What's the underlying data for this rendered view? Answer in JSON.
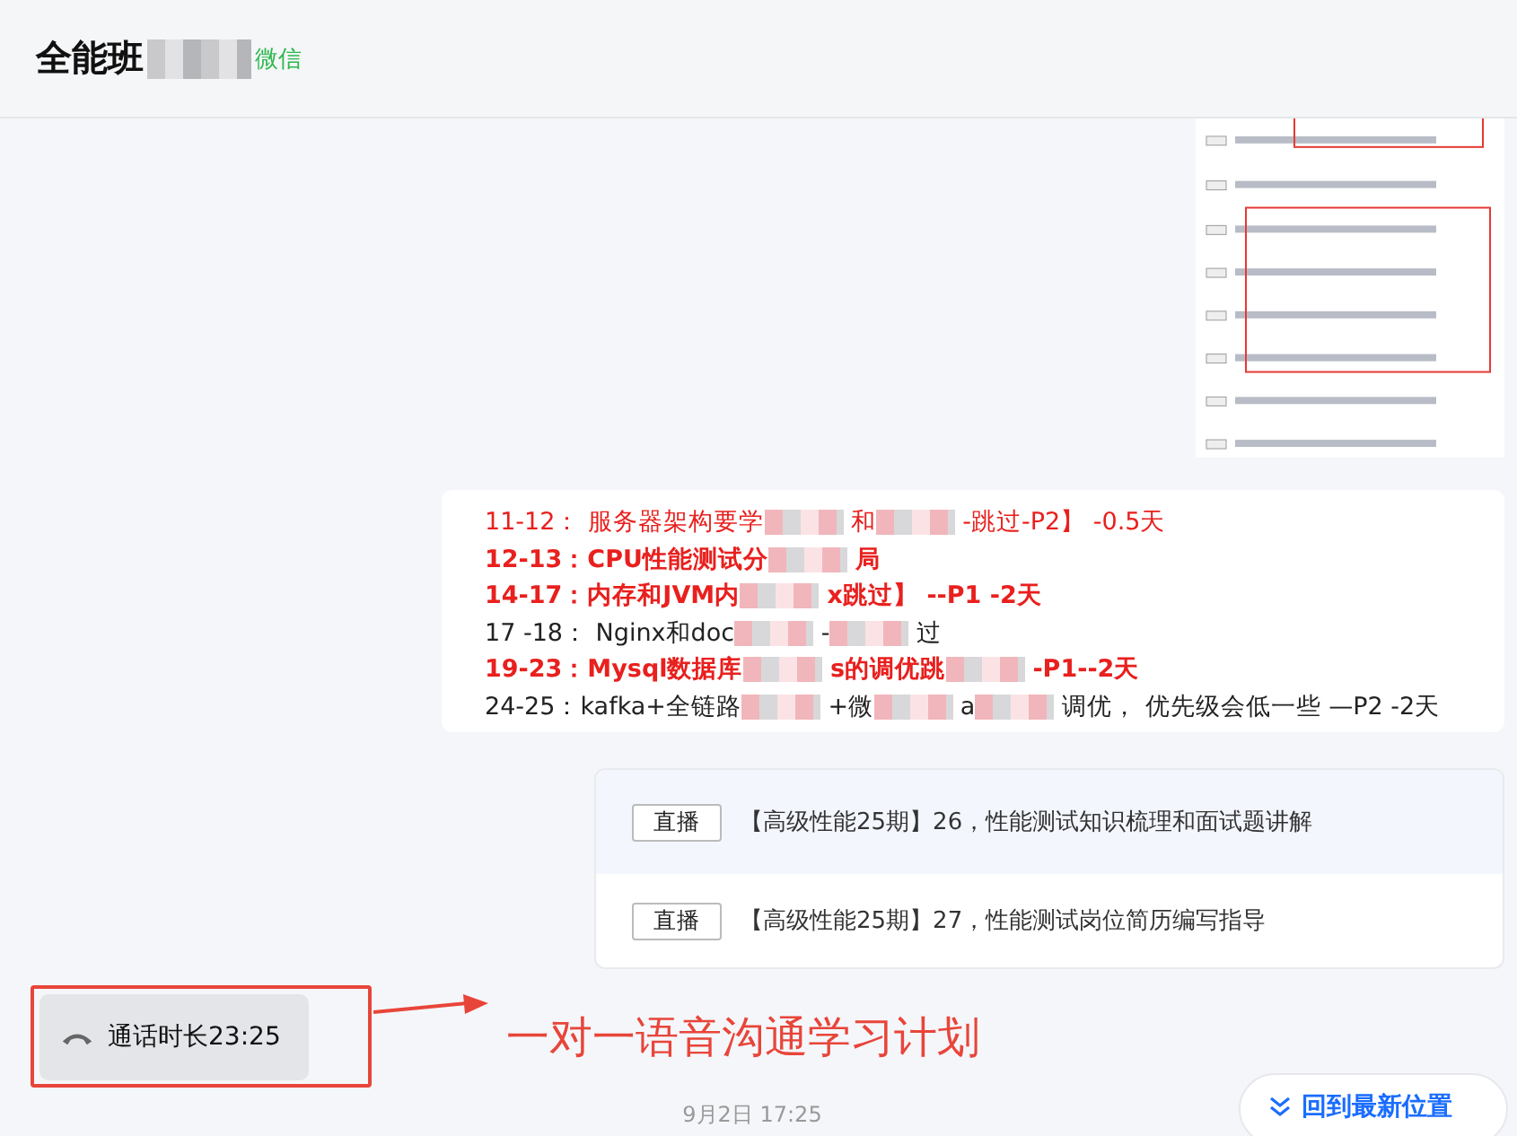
{
  "header": {
    "title": "全能班",
    "suffix": "微信"
  },
  "plan_message": {
    "lines": [
      {
        "kind": "highlight",
        "segments": [
          "11-12： 服务器架构要学",
          "和",
          "-跳过-P2】 -0.5天"
        ]
      },
      {
        "kind": "strong",
        "segments": [
          "12-13：CPU性能测试分",
          "局"
        ]
      },
      {
        "kind": "strong",
        "segments": [
          "14-17：内存和JVM内",
          "x跳过】 --P1   -2天"
        ]
      },
      {
        "kind": "normal",
        "segments": [
          "17 -18：  Nginx和doc",
          "-",
          "过"
        ]
      },
      {
        "kind": "strong",
        "segments": [
          "19-23：Mysql数据库",
          "s的调优跳",
          "-P1--2天"
        ]
      },
      {
        "kind": "normal",
        "segments": [
          "24-25：kafka+全链路",
          "+微",
          "a",
          "调优， 优先级会低一些 —P2  -2天"
        ]
      }
    ]
  },
  "course_message": {
    "items": [
      {
        "tag": "直播",
        "title": "【高级性能25期】26，性能测试知识梳理和面试题讲解",
        "selected": true
      },
      {
        "tag": "直播",
        "title": "【高级性能25期】27，性能测试岗位简历编写指导",
        "selected": false
      }
    ]
  },
  "call_message": {
    "text": "通话时长23:25"
  },
  "annotation": {
    "text": "一对一语音沟通学习计划"
  },
  "timestamp": "9月2日 17:25",
  "jump_button": {
    "label": "回到最新位置"
  }
}
